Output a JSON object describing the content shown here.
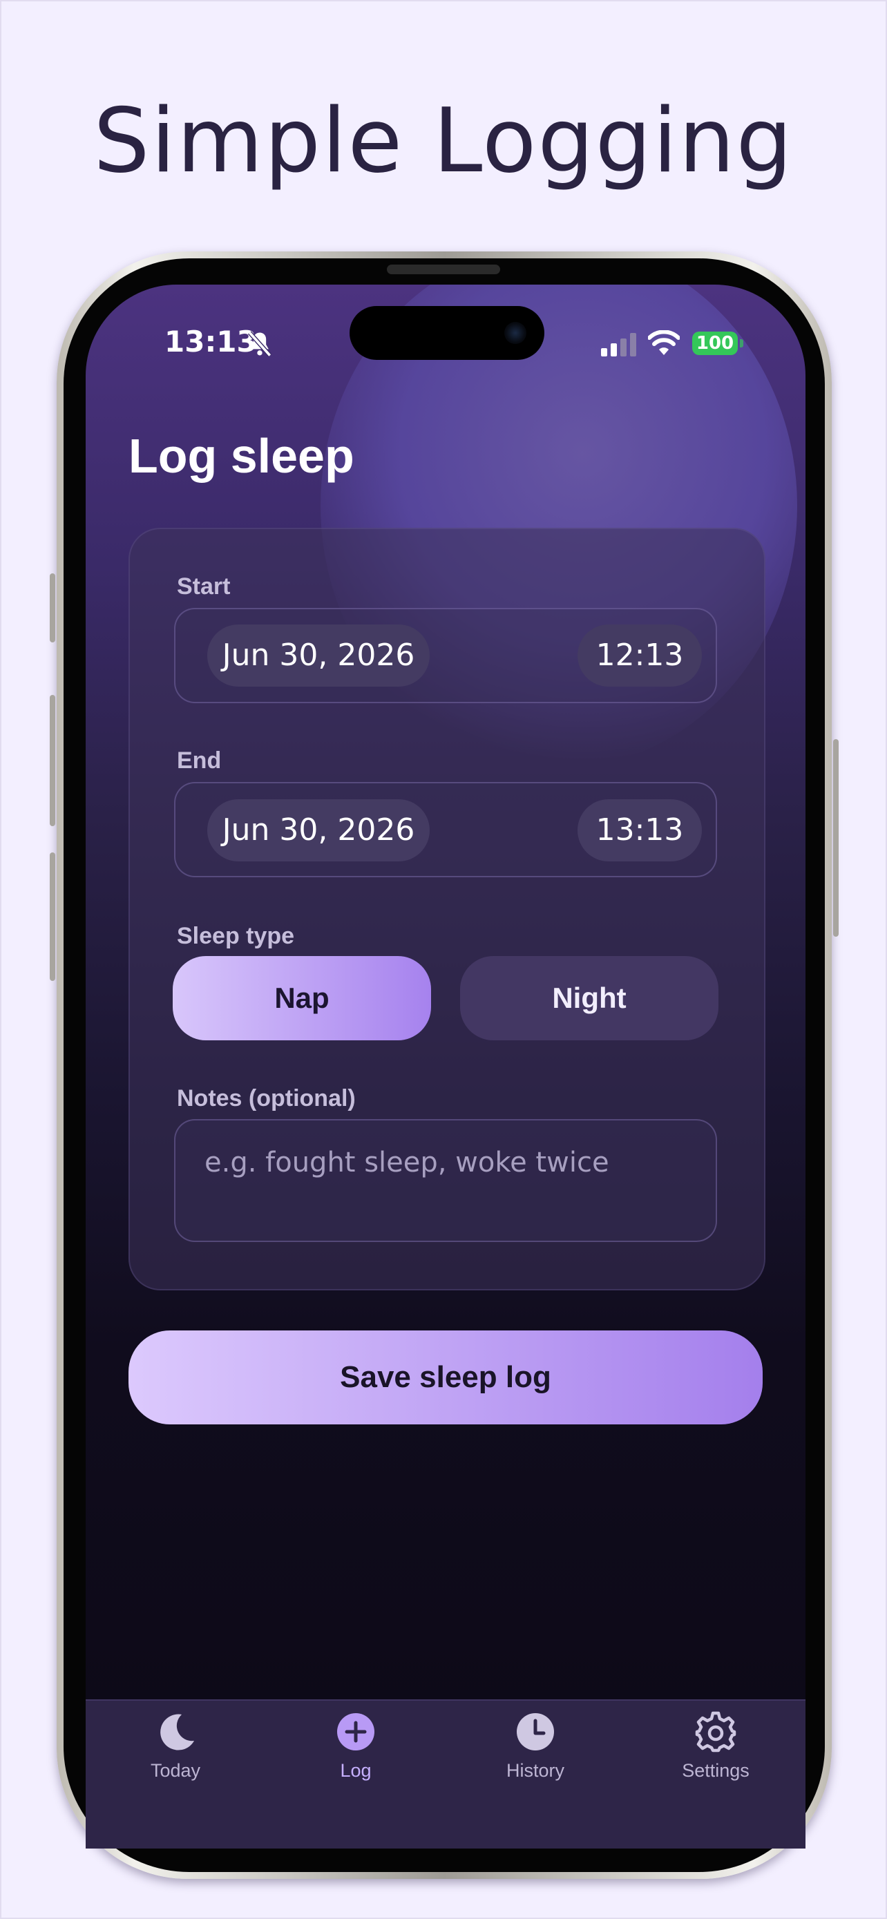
{
  "headline": "Simple Logging",
  "status_bar": {
    "time": "13:13",
    "battery": "100",
    "icons": [
      "bell-slash-icon",
      "signal-icon",
      "wifi-icon",
      "battery-icon"
    ]
  },
  "page_title": "Log sleep",
  "form": {
    "start": {
      "label": "Start",
      "date": "Jun 30, 2026",
      "time": "12:13"
    },
    "end": {
      "label": "End",
      "date": "Jun 30, 2026",
      "time": "13:13"
    },
    "sleep_type": {
      "label": "Sleep type",
      "options": [
        "Nap",
        "Night"
      ],
      "selected": "Nap"
    },
    "notes": {
      "label": "Notes (optional)",
      "placeholder": "e.g. fought sleep, woke twice"
    }
  },
  "save_label": "Save sleep log",
  "tabbar": {
    "items": [
      {
        "label": "Today",
        "icon": "moon-icon"
      },
      {
        "label": "Log",
        "icon": "plus-circle-icon"
      },
      {
        "label": "History",
        "icon": "clock-icon"
      },
      {
        "label": "Settings",
        "icon": "gear-icon"
      }
    ],
    "active": "Log"
  },
  "colors": {
    "accent": "#a682ee",
    "accent_light": "#d8c6fb",
    "background": "#f3efff",
    "card": "#3c325a",
    "battery": "#34c759"
  }
}
